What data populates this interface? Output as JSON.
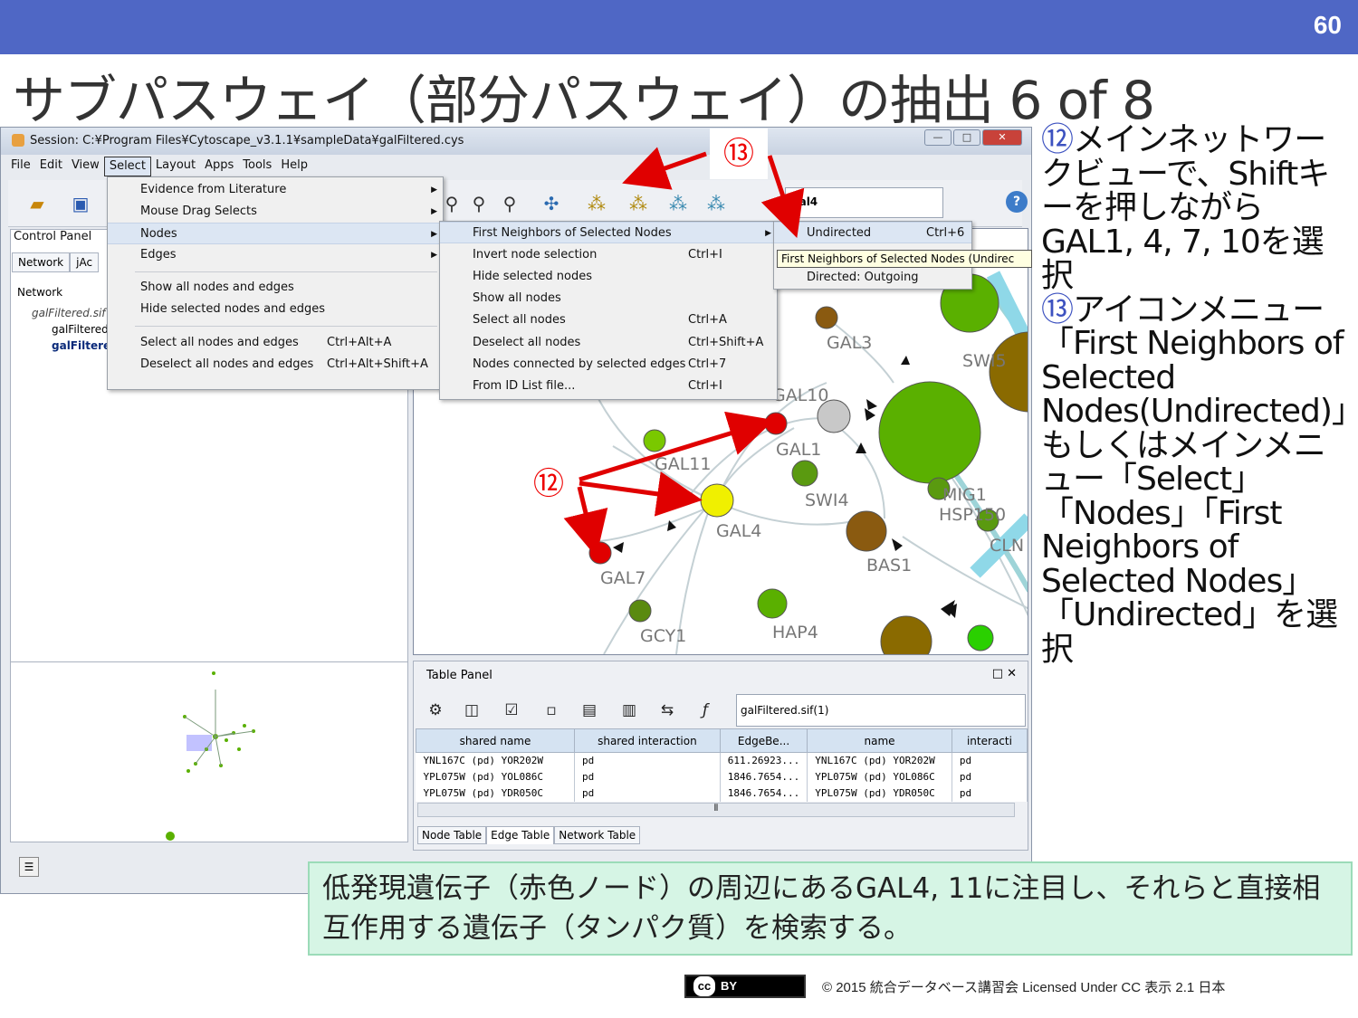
{
  "slide": {
    "page_number": "60",
    "title": "サブパスウェイ（部分パスウェイ）の抽出 6 of 8"
  },
  "window": {
    "title": "Session: C:¥Program Files¥Cytoscape_v3.1.1¥sampleData¥galFiltered.cys",
    "menubar": [
      "File",
      "Edit",
      "View",
      "Select",
      "Layout",
      "Apps",
      "Tools",
      "Help"
    ],
    "search_value": "gal4",
    "control_panel_label": "Control Panel",
    "left_tabs": [
      "Network",
      "jAc"
    ],
    "network_label": "Network",
    "tree": {
      "root": "galFiltered.sif",
      "children": [
        "galFiltered",
        "galFiltered"
      ]
    }
  },
  "select_menu": {
    "items": [
      {
        "label": "Evidence from Literature",
        "shortcut": ""
      },
      {
        "label": "Mouse Drag Selects",
        "shortcut": ""
      },
      {
        "label": "Nodes",
        "shortcut": ""
      },
      {
        "label": "Edges",
        "shortcut": ""
      },
      {
        "label": "Show all nodes and edges",
        "shortcut": ""
      },
      {
        "label": "Hide selected nodes and edges",
        "shortcut": ""
      },
      {
        "label": "Select all nodes and edges",
        "shortcut": "Ctrl+Alt+A"
      },
      {
        "label": "Deselect all nodes and edges",
        "shortcut": "Ctrl+Alt+Shift+A"
      }
    ]
  },
  "nodes_menu": {
    "items": [
      {
        "label": "First Neighbors of Selected Nodes",
        "shortcut": ""
      },
      {
        "label": "Invert node selection",
        "shortcut": "Ctrl+I"
      },
      {
        "label": "Hide selected nodes",
        "shortcut": ""
      },
      {
        "label": "Show all nodes",
        "shortcut": ""
      },
      {
        "label": "Select all nodes",
        "shortcut": "Ctrl+A"
      },
      {
        "label": "Deselect all nodes",
        "shortcut": "Ctrl+Shift+A"
      },
      {
        "label": "Nodes connected by selected edges",
        "shortcut": "Ctrl+7"
      },
      {
        "label": "From ID List file...",
        "shortcut": "Ctrl+I"
      }
    ]
  },
  "neighbors_menu": {
    "items": [
      {
        "label": "Undirected",
        "shortcut": "Ctrl+6"
      },
      {
        "label": "Directed: Outgoing",
        "shortcut": ""
      }
    ],
    "tooltip": "First Neighbors of Selected Nodes (Undirec"
  },
  "network": {
    "node_labels": [
      "GAL3",
      "GAL10",
      "GAL1",
      "GAL11",
      "SWI4",
      "MIG1",
      "HSP150",
      "GAL4",
      "GAL7",
      "BAS1",
      "CLN",
      "GCY1",
      "HAP4",
      "SWI5"
    ]
  },
  "table_panel": {
    "title": "Table Panel",
    "selected_table": "galFiltered.sif(1)",
    "columns": [
      "shared name",
      "shared interaction",
      "EdgeBe...",
      "name",
      "interacti"
    ],
    "rows": [
      [
        "YNL167C (pd) YOR202W",
        "pd",
        "611.26923...",
        "YNL167C (pd) YOR202W",
        "pd"
      ],
      [
        "YPL075W (pd) YOL086C",
        "pd",
        "1846.7654...",
        "YPL075W (pd) YOL086C",
        "pd"
      ],
      [
        "YPL075W (pd) YDR050C",
        "pd",
        "1846.7654...",
        "YPL075W (pd) YDR050C",
        "pd"
      ]
    ],
    "bottom_tabs": [
      "Node Table",
      "Edge Table",
      "Network Table"
    ]
  },
  "annotations": {
    "badge12": "⑫",
    "badge13": "⑬"
  },
  "side_text": {
    "n12": "⑫",
    "t12": "メインネットワークビューで、Shiftキーを押しながらGAL1, 4, 7, 10を選択",
    "n13": "⑬",
    "t13": "アイコンメニュー「First Neighbors of Selected Nodes(Undirected)」もしくはメインメニュー「Select」「Nodes」「First Neighbors of Selected Nodes」「Undirected」を選択"
  },
  "note": "低発現遺伝子（赤色ノード）の周辺にあるGAL4, 11に注目し、それらと直接相互作用する遺伝子（タンパク質）を検索する。",
  "footer": {
    "cc_label": "BY",
    "text": "© 2015 統合データベース講習会 Licensed Under CC 表示 2.1 日本"
  },
  "colors": {
    "header": "#4f67c5",
    "accent_red": "#e00000",
    "note_bg": "#d6f5e5",
    "node_green": "#5ab000",
    "node_brown": "#8a5a10"
  }
}
